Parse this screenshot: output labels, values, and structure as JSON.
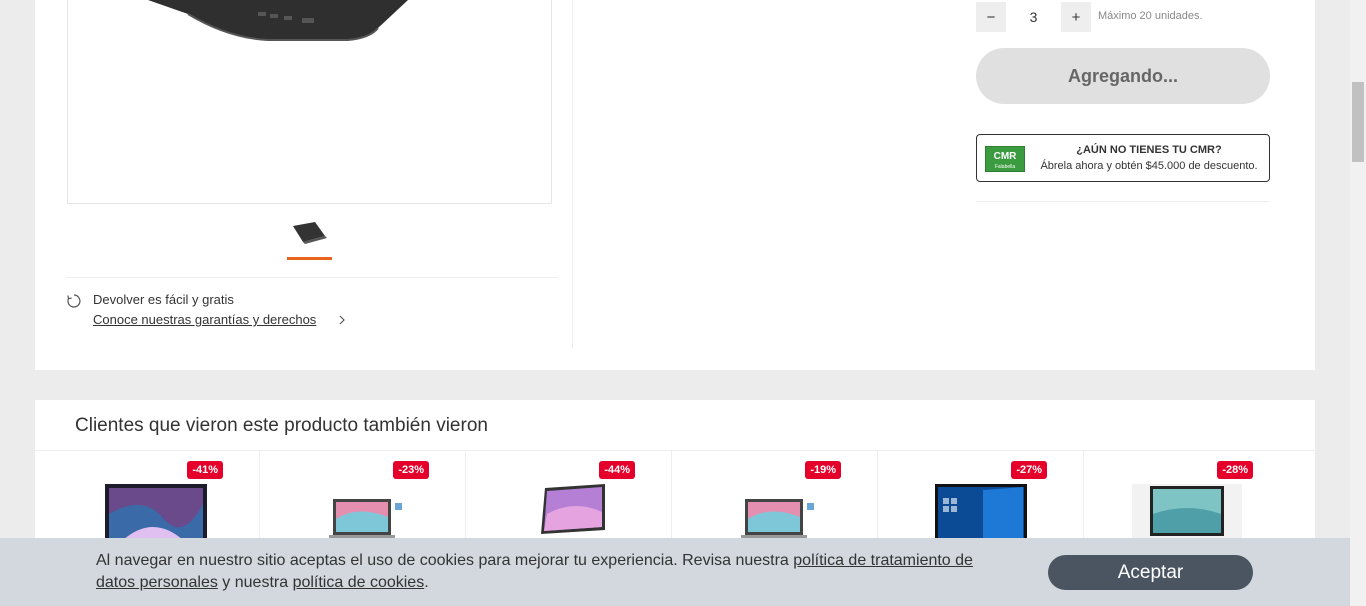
{
  "product": {
    "thumbnail_alt": "laptop"
  },
  "returns": {
    "line1": "Devolver es fácil y gratis",
    "link": "Conoce nuestras garantías y derechos"
  },
  "quantity": {
    "minus": "−",
    "value": "3",
    "plus": "+",
    "note": "Máximo 20 unidades."
  },
  "add_button": "Agregando...",
  "cmr": {
    "logo": "CMR",
    "logo_sub": "Falabella",
    "title": "¿AÚN NO TIENES TU CMR?",
    "subtitle": "Ábrela ahora y obtén $45.000 de descuento."
  },
  "recommendations": {
    "title": "Clientes que vieron este producto también vieron",
    "items": [
      {
        "discount": "-41%"
      },
      {
        "discount": "-23%"
      },
      {
        "discount": "-44%"
      },
      {
        "discount": "-19%"
      },
      {
        "discount": "-27%"
      },
      {
        "discount": "-28%"
      }
    ]
  },
  "cookie": {
    "text_before": "Al navegar en nuestro sitio aceptas el uso de cookies para mejorar tu experiencia. Revisa nuestra ",
    "link1": "política de tratamiento de datos personales",
    "text_mid": " y nuestra ",
    "link2": "política de cookies",
    "text_after": ".",
    "accept": "Aceptar"
  },
  "colors": {
    "accent": "#e8631c",
    "badge": "#e4002b",
    "cmr_green": "#3a9b3f"
  }
}
